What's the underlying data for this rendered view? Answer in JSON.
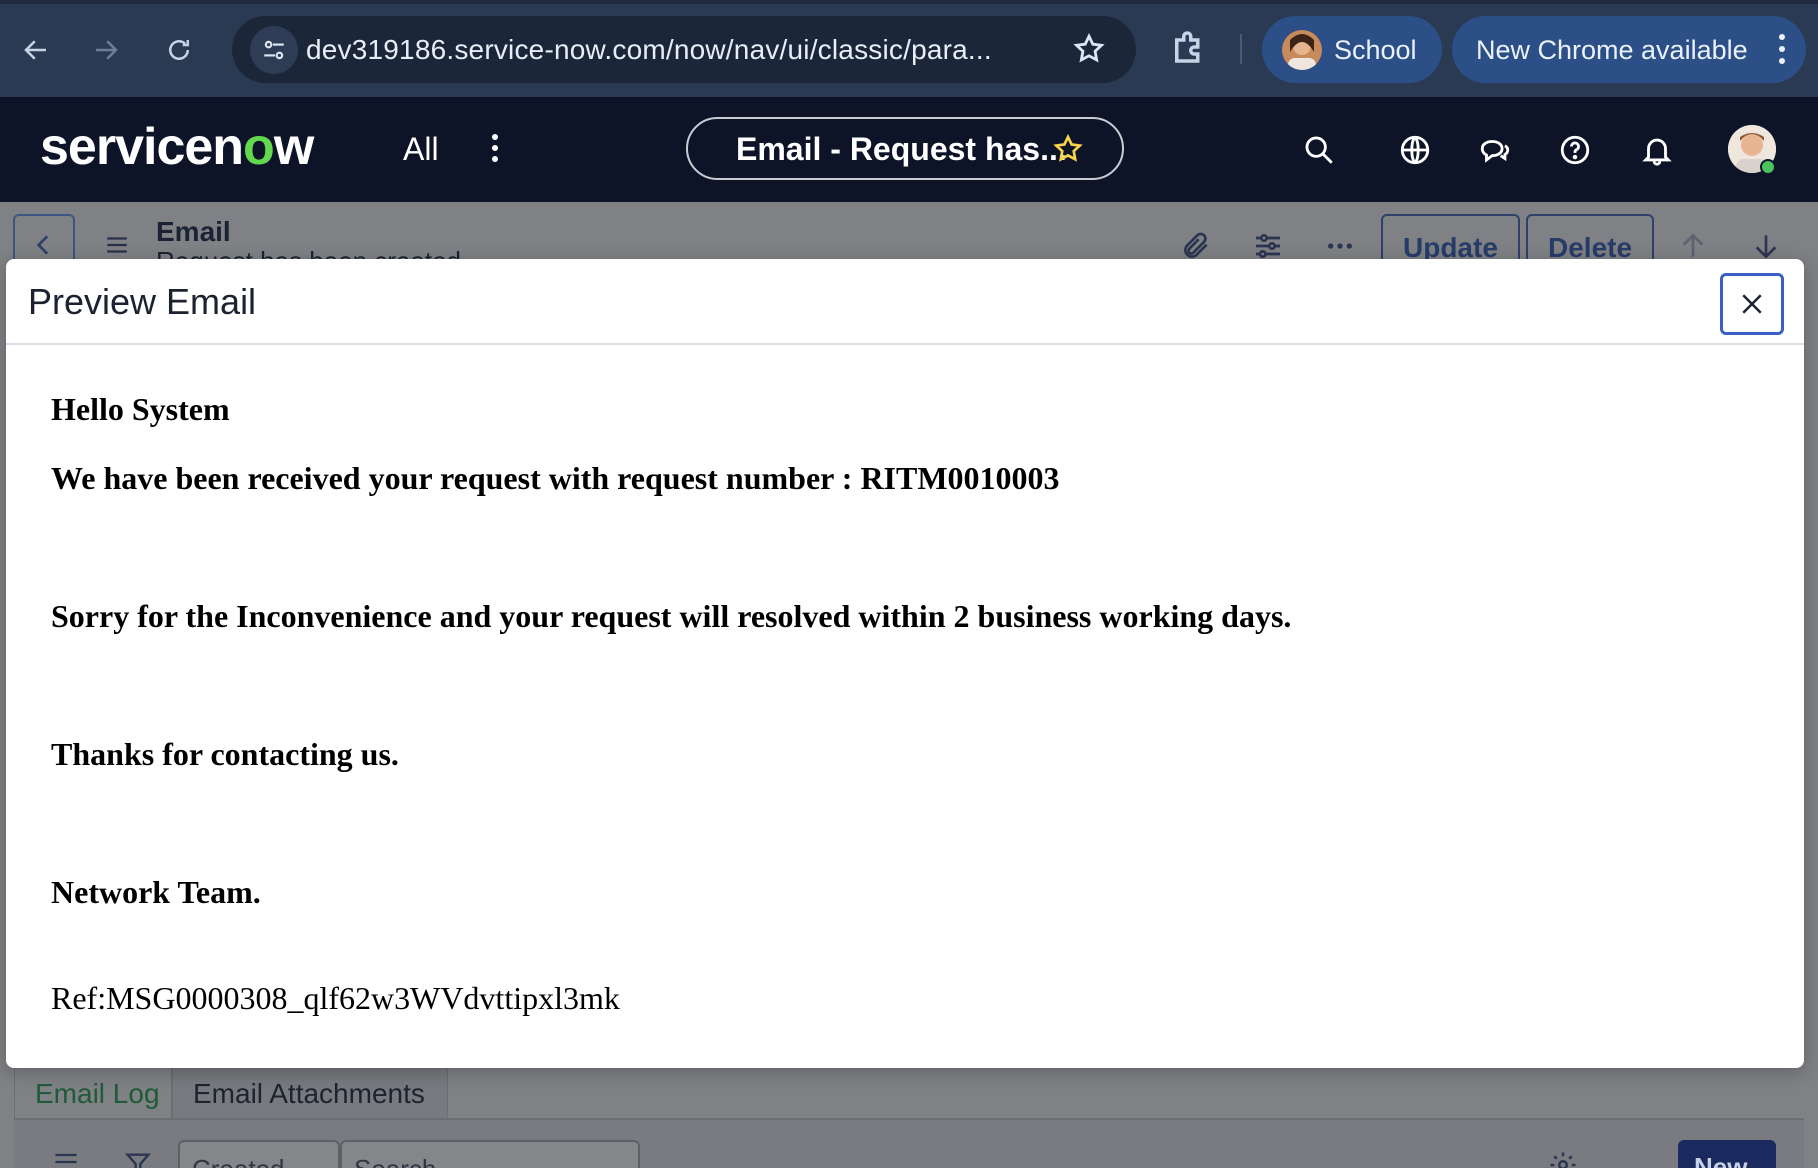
{
  "browser": {
    "url": "dev319186.service-now.com/now/nav/ui/classic/para...",
    "profile_label": "School",
    "update_label": "New Chrome available",
    "icons": [
      "back-icon",
      "forward-icon",
      "reload-icon",
      "site-settings-icon",
      "bookmark-star-icon",
      "extensions-icon",
      "more-vert-icon"
    ]
  },
  "servicenow": {
    "logo_parts": {
      "pre": "servicen",
      "o": "o",
      "post": "w"
    },
    "all_label": "All",
    "pill_title": "Email - Request has...",
    "header_icons": [
      "search-icon",
      "globe-icon",
      "chat-icon",
      "help-icon",
      "bell-icon"
    ]
  },
  "form": {
    "title": "Email",
    "subtitle": "Request has been created",
    "update_label": "Update",
    "delete_label": "Delete",
    "tabs": [
      {
        "label": "Email Log"
      },
      {
        "label": "Email Attachments"
      }
    ],
    "list_field_1": "Created",
    "list_field_2": "Search",
    "new_label": "New"
  },
  "modal": {
    "title": "Preview Email",
    "body": {
      "greeting": "Hello System",
      "line_received": "We have been received your request with request number : RITM0010003",
      "line_sorry": "Sorry for the Inconvenience and your request will resolved within 2 business working days.",
      "line_thanks": "Thanks for contacting us.",
      "signature": "Network Team.",
      "ref": "Ref:MSG0000308_qlf62w3WVdvttipxl3mk"
    }
  },
  "colors": {
    "chrome_bg": "#2a3a52",
    "sn_header_bg": "#0d1428",
    "accent_green": "#62d84e",
    "close_focus": "#3b5fc7"
  }
}
